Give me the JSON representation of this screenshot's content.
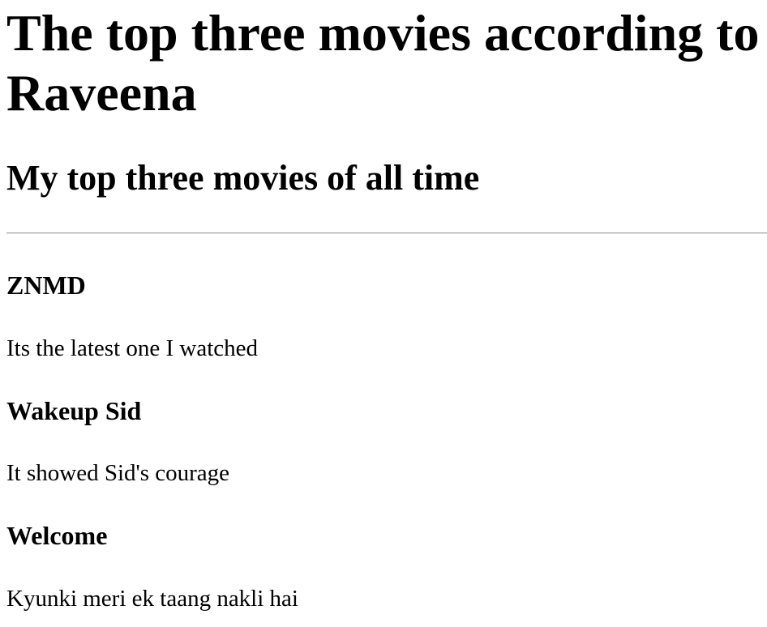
{
  "page": {
    "title": "The top three movies according to Raveena",
    "subtitle": "My top three movies of all time"
  },
  "movies": [
    {
      "name": "ZNMD",
      "description": "Its the latest one I watched"
    },
    {
      "name": "Wakeup Sid",
      "description": "It showed Sid's courage"
    },
    {
      "name": "Welcome",
      "description": "Kyunki meri ek taang nakli hai"
    }
  ]
}
